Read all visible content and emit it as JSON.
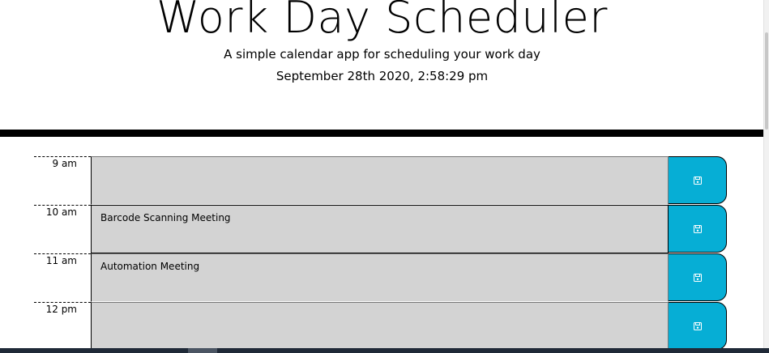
{
  "header": {
    "title": "Work Day Scheduler",
    "lead": "A simple calendar app for scheduling your work day",
    "current_day": "September 28th 2020, 2:58:29 pm"
  },
  "time_blocks": [
    {
      "hour": "9 am",
      "text": "",
      "icon": "floppy-disk-icon"
    },
    {
      "hour": "10 am",
      "text": "Barcode Scanning Meeting",
      "icon": "floppy-disk-icon"
    },
    {
      "hour": "11 am",
      "text": "Automation Meeting",
      "icon": "floppy-disk-icon"
    },
    {
      "hour": "12 pm",
      "text": "",
      "icon": "floppy-disk-icon"
    }
  ],
  "colors": {
    "save_button": "#06aed5",
    "description_bg": "#d3d3d3",
    "divider": "#000000"
  }
}
